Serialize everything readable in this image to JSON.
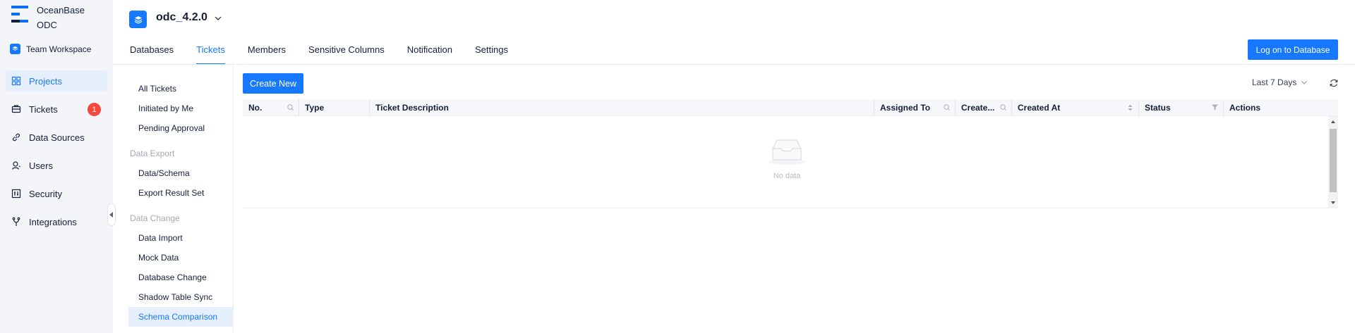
{
  "brand": {
    "line1": "OceanBase",
    "line2": "ODC"
  },
  "workspace": {
    "label": "Team Workspace"
  },
  "nav": {
    "items": [
      {
        "label": "Projects",
        "icon": "grid-icon",
        "active": true
      },
      {
        "label": "Tickets",
        "icon": "ticket-icon",
        "badge": "1"
      },
      {
        "label": "Data Sources",
        "icon": "link-icon"
      },
      {
        "label": "Users",
        "icon": "user-icon"
      },
      {
        "label": "Security",
        "icon": "sliders-icon"
      },
      {
        "label": "Integrations",
        "icon": "fork-icon"
      }
    ]
  },
  "project": {
    "name": "odc_4.2.0"
  },
  "tabs": [
    "Databases",
    "Tickets",
    "Members",
    "Sensitive Columns",
    "Notification",
    "Settings"
  ],
  "active_tab": "Tickets",
  "header": {
    "login_button": "Log on to Database"
  },
  "submenu": {
    "items": [
      "All Tickets",
      "Initiated by Me",
      "Pending Approval"
    ],
    "group_export": "Data Export",
    "export_items": [
      "Data/Schema",
      "Export Result Set"
    ],
    "group_change": "Data Change",
    "change_items": [
      "Data Import",
      "Mock Data",
      "Database Change",
      "Shadow Table Sync",
      "Schema Comparison"
    ],
    "active": "Schema Comparison"
  },
  "toolbar": {
    "create_button": "Create New",
    "range": "Last 7 Days"
  },
  "table": {
    "columns": [
      "No.",
      "Type",
      "Ticket Description",
      "Assigned To",
      "Create...",
      "Created At",
      "Status",
      "Actions"
    ],
    "empty_text": "No data"
  },
  "colors": {
    "primary": "#1677ff",
    "badge": "#f5483b",
    "sidebar_bg": "#f3f5f8"
  }
}
